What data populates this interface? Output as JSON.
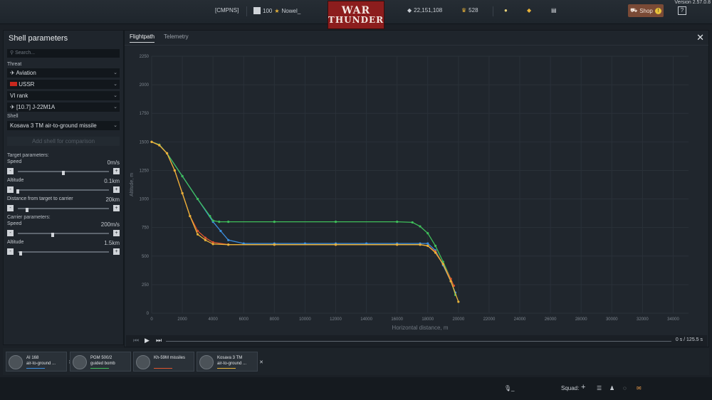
{
  "topbar": {
    "version": "Version 2.57.0.8",
    "squadron": "[CMPNS]",
    "level": "100",
    "nickname": "Nowel_",
    "silver_lions": "22,151,108",
    "golden_eagles": "528",
    "shop_label": "Shop",
    "help_label": "?"
  },
  "logo": {
    "line1": "WAR",
    "line2": "THUNDER"
  },
  "left_panel": {
    "title": "Shell parameters",
    "search_placeholder": "Search...",
    "threat_label": "Threat",
    "threat_options": [
      "Aviation",
      "USSR",
      "VI rank",
      "[10.7] J-22M1A"
    ],
    "shell_label": "Shell",
    "shell_value": "Kosava 3 TM air-to-ground missile",
    "add_shell_label": "Add shell for comparison",
    "target_params_label": "Target parameters:",
    "carrier_params_label": "Carrier parameters:",
    "params": [
      {
        "label": "Speed",
        "value": "0m/s",
        "level": 0.5
      },
      {
        "label": "Altitude",
        "value": "0.1km",
        "level": 0.0
      },
      {
        "label": "Distance from target to carrier",
        "value": "20km",
        "level": 0.1
      },
      {
        "label": "Speed",
        "value": "200m/s",
        "level": 0.38
      },
      {
        "label": "Altitude",
        "value": "1.5km",
        "level": 0.03
      }
    ]
  },
  "tabs": [
    {
      "label": "Flightpath",
      "active": true
    },
    {
      "label": "Telemetry",
      "active": false
    }
  ],
  "playbar": {
    "time": "0 s  /  125.5 s"
  },
  "shells": [
    {
      "name_line1": "AI 168",
      "name_line2": "air-to-ground ...",
      "color": "#3b8fe0"
    },
    {
      "name_line1": "PGM 500/2",
      "name_line2": "guided bomb",
      "color": "#3fbf5a"
    },
    {
      "name_line1": "Kh-59M missiles",
      "name_line2": "",
      "color": "#e0552e"
    },
    {
      "name_line1": "Kosava 3 TM",
      "name_line2": "air-to-ground ...",
      "color": "#e8b33a"
    }
  ],
  "footer": {
    "mic": "_",
    "squad_label": "Squad:"
  },
  "chart_data": {
    "type": "line",
    "xlabel": "Horizontal distance, m",
    "ylabel": "Altitude, m",
    "xlim": [
      0,
      35000
    ],
    "ylim": [
      0,
      2250
    ],
    "xticks": [
      0,
      2000,
      4000,
      6000,
      8000,
      10000,
      12000,
      14000,
      16000,
      18000,
      20000,
      22000,
      24000,
      26000,
      28000,
      30000,
      32000,
      34000
    ],
    "yticks": [
      0,
      250,
      500,
      750,
      1000,
      1250,
      1500,
      1750,
      2000,
      2250
    ],
    "grid": true,
    "series": [
      {
        "color": "#3b8fe0",
        "x": [
          0,
          500,
          1000,
          2000,
          3000,
          4000,
          4500,
          5000,
          6000,
          8000,
          10000,
          12000,
          14000,
          16000,
          17500,
          18000,
          18500,
          19000,
          19500,
          19800
        ],
        "y": [
          1500,
          1475,
          1400,
          1200,
          1000,
          800,
          720,
          640,
          610,
          610,
          610,
          610,
          610,
          610,
          610,
          610,
          550,
          420,
          280,
          180
        ]
      },
      {
        "color": "#3fbf5a",
        "x": [
          0,
          500,
          1000,
          2000,
          3000,
          3800,
          4000,
          4400,
          5000,
          8000,
          12000,
          16000,
          17000,
          17500,
          18000,
          18500,
          19000,
          19500,
          19800
        ],
        "y": [
          1500,
          1475,
          1400,
          1200,
          1000,
          850,
          810,
          800,
          800,
          800,
          800,
          800,
          795,
          760,
          700,
          590,
          450,
          300,
          160
        ]
      },
      {
        "color": "#e0552e",
        "x": [
          0,
          500,
          1000,
          1500,
          2000,
          2500,
          3000,
          3500,
          4000,
          5000,
          8000,
          12000,
          16000,
          17500,
          18000,
          18500,
          19000,
          19500,
          19700
        ],
        "y": [
          1500,
          1470,
          1400,
          1250,
          1050,
          850,
          720,
          660,
          620,
          600,
          600,
          600,
          600,
          600,
          590,
          540,
          430,
          300,
          240
        ]
      },
      {
        "color": "#e8b33a",
        "x": [
          0,
          500,
          1000,
          1500,
          2000,
          2500,
          3000,
          3500,
          4000,
          5000,
          8000,
          12000,
          16000,
          17500,
          18000,
          18500,
          19000,
          19500,
          20000
        ],
        "y": [
          1500,
          1470,
          1400,
          1250,
          1050,
          850,
          690,
          640,
          605,
          600,
          600,
          600,
          600,
          600,
          590,
          530,
          430,
          280,
          100
        ]
      }
    ]
  }
}
